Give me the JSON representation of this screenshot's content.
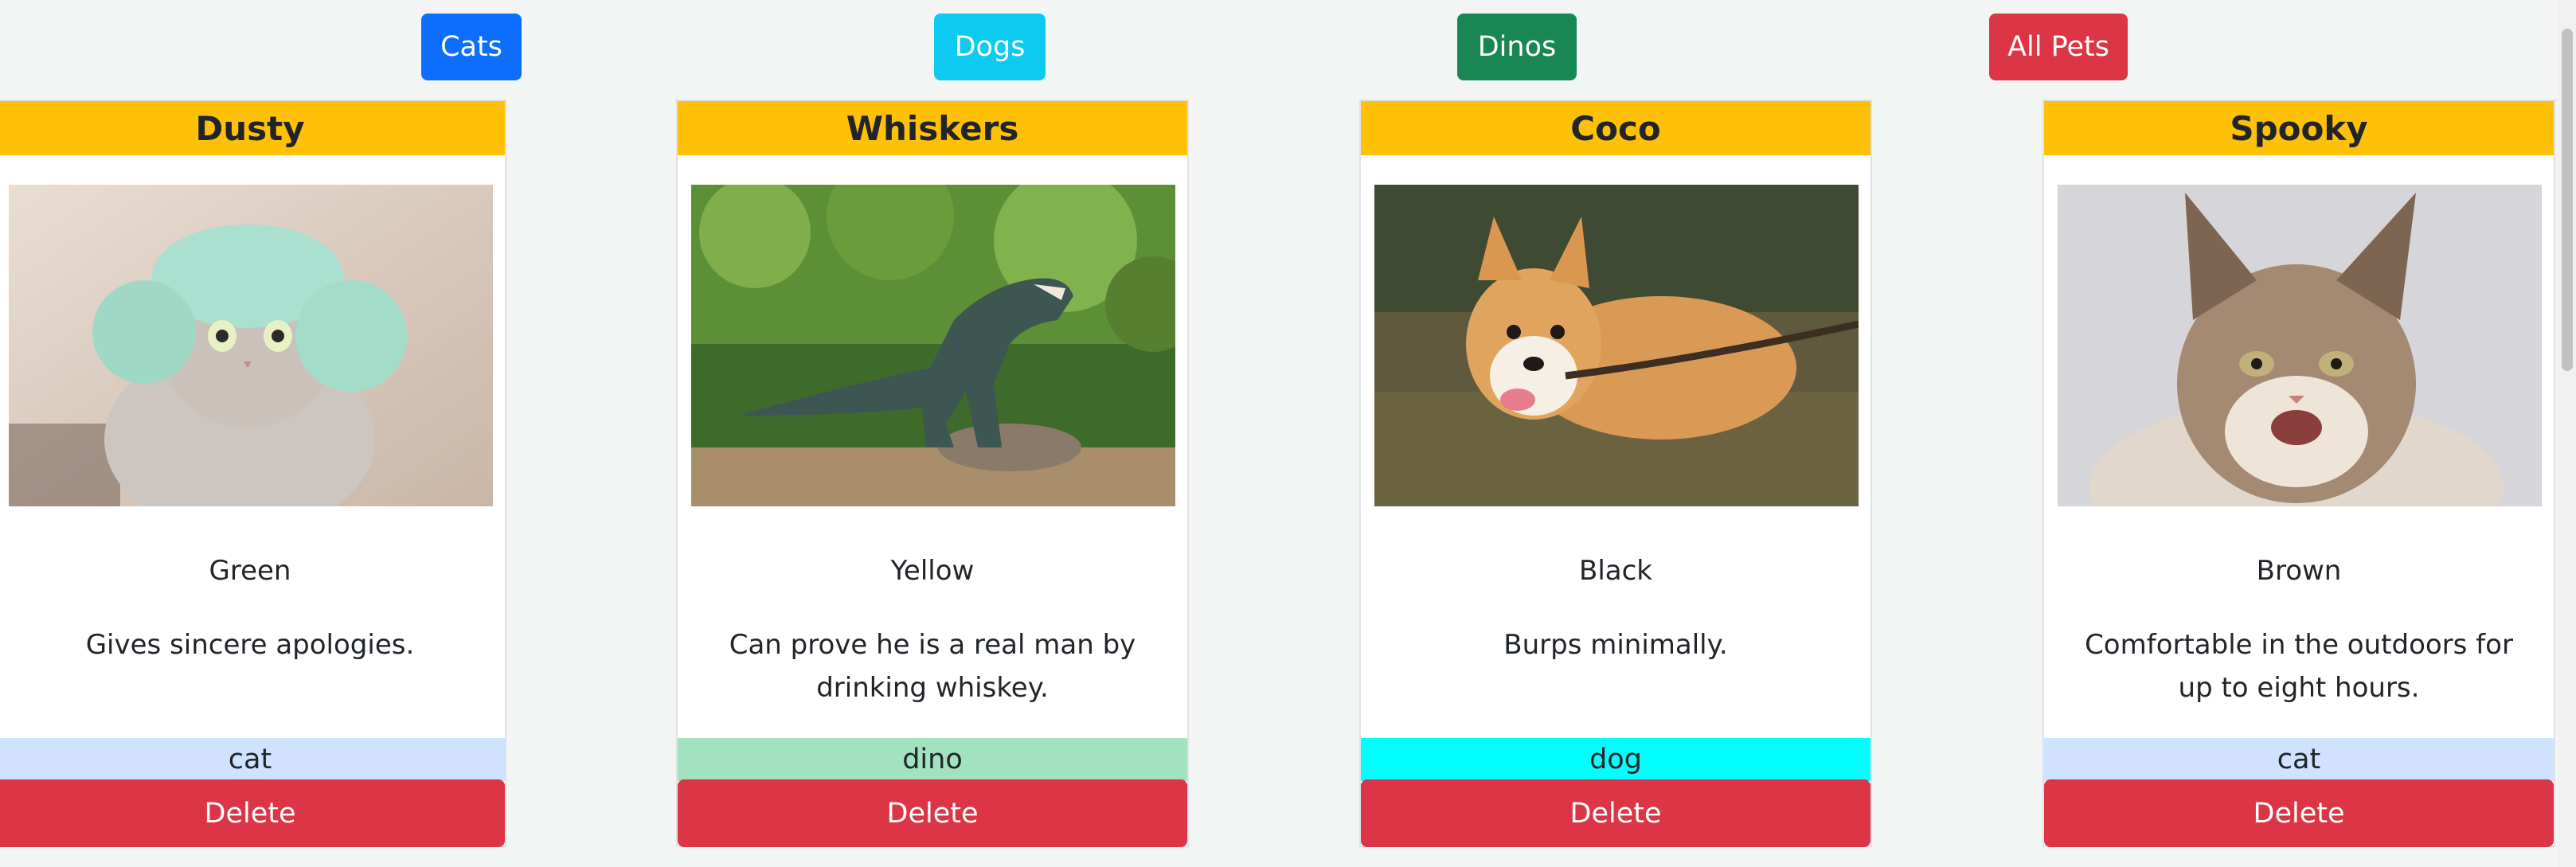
{
  "filters": {
    "cats": "Cats",
    "dogs": "Dogs",
    "dinos": "Dinos",
    "all": "All Pets"
  },
  "pets": [
    {
      "name": "Dusty",
      "image": "cat-in-green-knit-hat-photo",
      "color": "Green",
      "description": "Gives sincere apologies.",
      "type": "cat",
      "delete_label": "Delete"
    },
    {
      "name": "Whiskers",
      "image": "t-rex-statue-in-forest-photo",
      "color": "Yellow",
      "description": "Can prove he is a real man by drinking whiskey.",
      "type": "dino",
      "delete_label": "Delete"
    },
    {
      "name": "Coco",
      "image": "corgi-with-stick-photo",
      "color": "Black",
      "description": "Burps minimally.",
      "type": "dog",
      "delete_label": "Delete"
    },
    {
      "name": "Spooky",
      "image": "maine-coon-cat-photo",
      "color": "Brown",
      "description": "Comfortable in the outdoors for up to eight hours.",
      "type": "cat",
      "delete_label": "Delete"
    }
  ],
  "colors": {
    "header": "#ffc107",
    "cats_button": "#0d6efd",
    "dogs_button": "#0dcaf0",
    "dinos_button": "#198754",
    "all_button": "#dc3545",
    "delete_button": "#dc3545",
    "type_cat": "#cfe2ff",
    "type_dino": "#a3e2c1",
    "type_dog": "#00ffff"
  }
}
